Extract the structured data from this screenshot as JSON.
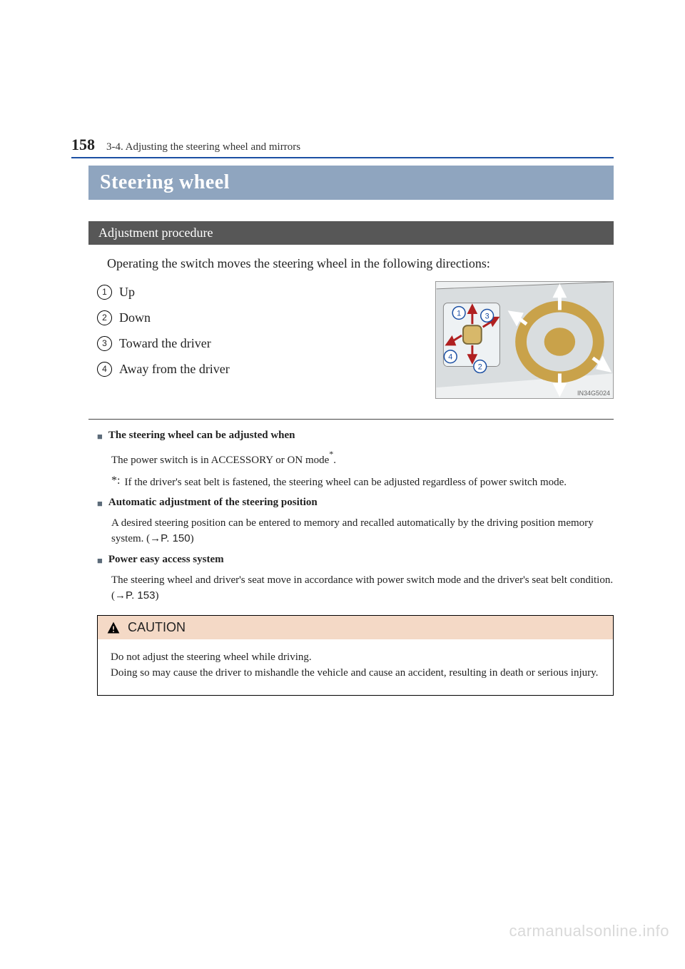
{
  "header": {
    "page_number": "158",
    "section": "3-4. Adjusting the steering wheel and mirrors"
  },
  "title": "Steering wheel",
  "subsection": "Adjustment procedure",
  "intro": "Operating the switch moves the steering wheel in the following directions:",
  "directions": [
    {
      "num": "1",
      "label": "Up"
    },
    {
      "num": "2",
      "label": "Down"
    },
    {
      "num": "3",
      "label": "Toward the driver"
    },
    {
      "num": "4",
      "label": "Away from the driver"
    }
  ],
  "illustration_code": "IN34G5024",
  "notes": [
    {
      "title": "The steering wheel can be adjusted when",
      "body": "The power switch is in ACCESSORY or ON mode",
      "has_star": true,
      "footnote": "If the driver's seat belt is fastened, the steering wheel can be adjusted regardless of power switch mode.",
      "xref": ""
    },
    {
      "title": "Automatic adjustment of the steering position",
      "body": "A desired steering position can be entered to memory and recalled automatically by the driving position memory system. (",
      "xref": "→P. 150",
      "body_after": ")"
    },
    {
      "title": "Power easy access system",
      "body": "The steering wheel and driver's seat move in accordance with power switch mode and the driver's seat belt condition. (",
      "xref": "→P. 153",
      "body_after": ")"
    }
  ],
  "caution": {
    "label": "CAUTION",
    "line1": "Do not adjust the steering wheel while driving.",
    "line2": "Doing so may cause the driver to mishandle the vehicle and cause an accident, resulting in death or serious injury."
  },
  "watermark": "carmanualsonline.info"
}
